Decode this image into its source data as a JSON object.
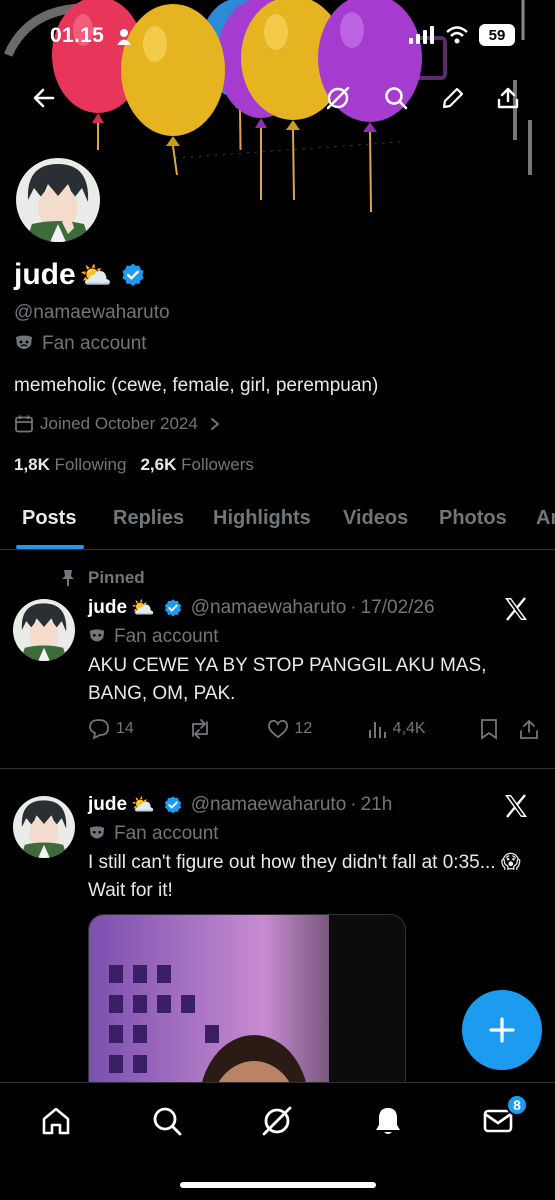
{
  "status_bar": {
    "time": "01.15",
    "battery": "59"
  },
  "profile": {
    "display_name": "jude",
    "name_emoji": "⛅",
    "handle": "@namaewaharuto",
    "category": "Fan account",
    "bio": "memeholic (cewe, female, girl, perempuan)",
    "joined": "Joined October 2024",
    "following_count": "1,8K",
    "following_label": "Following",
    "followers_count": "2,6K",
    "followers_label": "Followers"
  },
  "tabs": [
    "Posts",
    "Replies",
    "Highlights",
    "Videos",
    "Photos",
    "Ar"
  ],
  "posts": [
    {
      "pinned_label": "Pinned",
      "name": "jude",
      "emoji": "⛅",
      "handle": "@namaewaharuto",
      "separator": "·",
      "time": "17/02/26",
      "category": "Fan account",
      "text": "AKU CEWE YA BY STOP PANGGIL AKU MAS, BANG, OM, PAK.",
      "replies": "14",
      "likes": "12",
      "views": "4,4K"
    },
    {
      "name": "jude",
      "emoji": "⛅",
      "handle": "@namaewaharuto",
      "separator": "·",
      "time": "21h",
      "category": "Fan account",
      "text": "I still can't figure out how they didn't fall at 0:35... 😱 Wait for it!"
    }
  ],
  "nav": {
    "messages_badge": "8"
  },
  "colors": {
    "accent": "#1d9bf0",
    "background": "#000000",
    "muted": "#71767b"
  }
}
